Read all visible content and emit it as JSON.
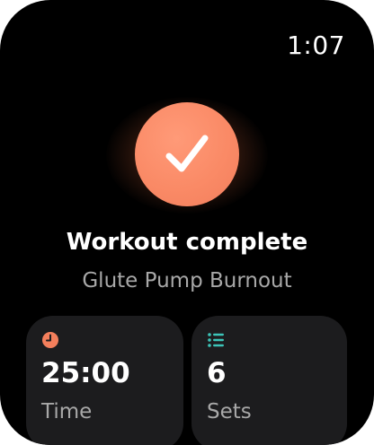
{
  "status_bar": {
    "time": "1:07"
  },
  "completion": {
    "title": "Workout complete",
    "workout_name": "Glute Pump Burnout",
    "accent_color": "#fa8a66"
  },
  "stats": [
    {
      "icon": "clock-icon",
      "value": "25:00",
      "label": "Time",
      "icon_color": "#f47f5c"
    },
    {
      "icon": "list-icon",
      "value": "6",
      "label": "Sets",
      "icon_color": "#3cc4b8"
    }
  ]
}
